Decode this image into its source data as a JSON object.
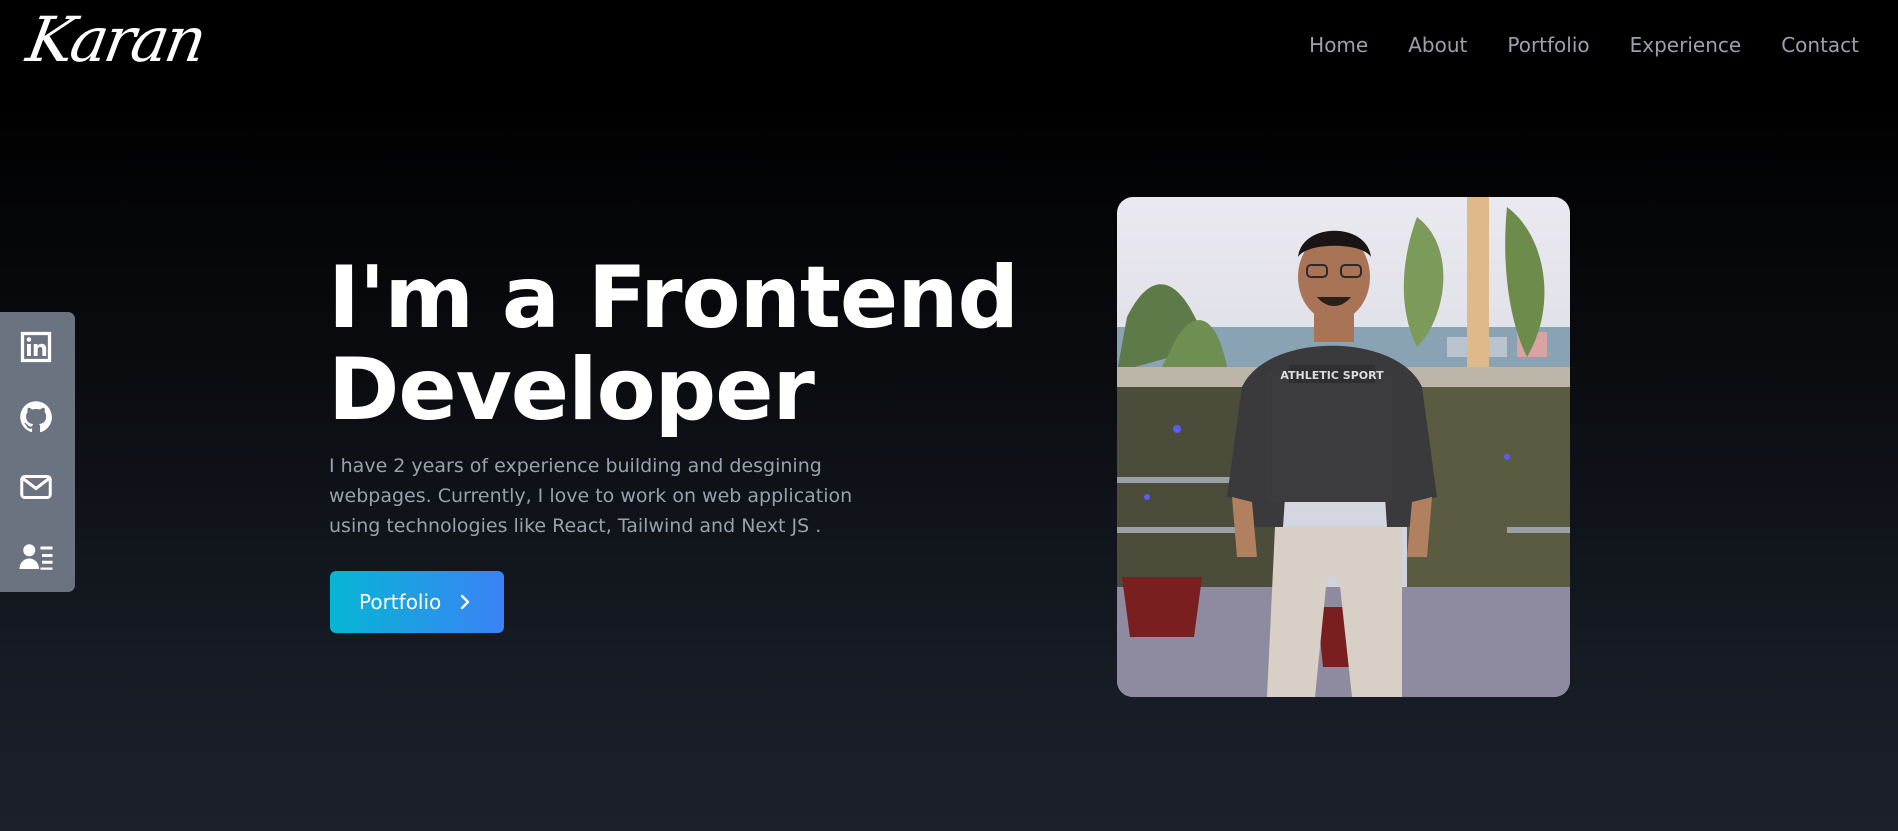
{
  "header": {
    "logo_text": "Karan",
    "nav": [
      {
        "label": "Home"
      },
      {
        "label": "About"
      },
      {
        "label": "Portfolio"
      },
      {
        "label": "Experience"
      },
      {
        "label": "Contact"
      }
    ]
  },
  "sidebar": {
    "items": [
      {
        "icon": "linkedin-icon"
      },
      {
        "icon": "github-icon"
      },
      {
        "icon": "mail-icon"
      },
      {
        "icon": "resume-icon"
      }
    ]
  },
  "hero": {
    "headline_line1": "I'm a Frontend",
    "headline_line2": "Developer",
    "description": "I have 2 years of experience building and desgining webpages. Currently, I love to work on web application using technologies like React, Tailwind and Next JS .",
    "button_label": "Portfolio",
    "photo_shirt_text": "ATHLETIC SPORT"
  },
  "colors": {
    "nav_text": "#9aa1ad",
    "sidebar_bg": "#6b7280",
    "button_gradient_start": "#06b6d4",
    "button_gradient_end": "#3b82f6"
  }
}
